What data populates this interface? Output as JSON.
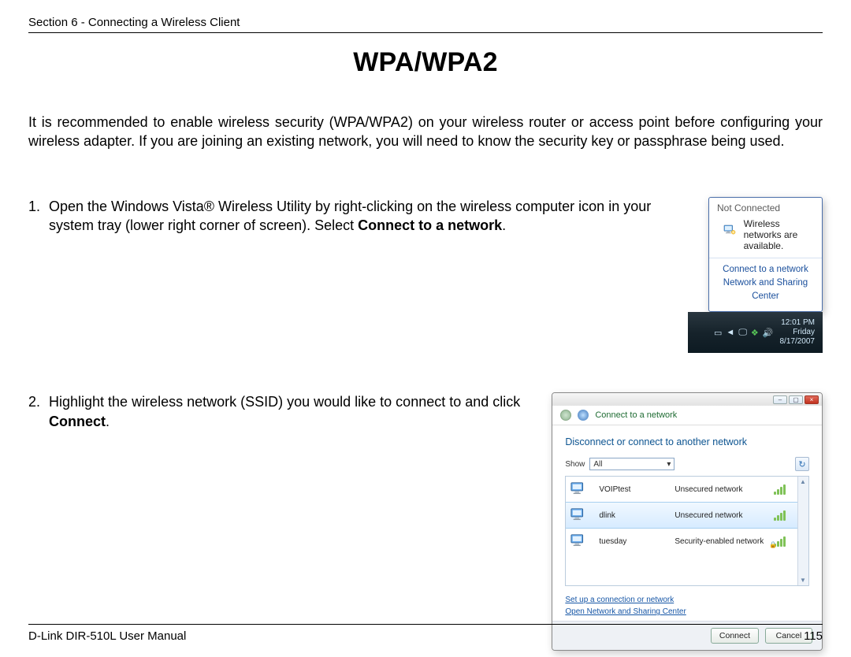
{
  "header": {
    "section": "Section 6 - Connecting a Wireless Client"
  },
  "title": "WPA/WPA2",
  "intro": "It is recommended to enable wireless security (WPA/WPA2) on your wireless router or access point before configuring your wireless adapter. If you are joining an existing network, you will need to know the security key or passphrase being used.",
  "steps": {
    "s1_a": "Open the Windows Vista® Wireless Utility by right-clicking on the wireless computer icon in your system tray (lower right corner of screen). Select ",
    "s1_b": "Connect to a network",
    "s1_c": ".",
    "s2_a": "Highlight the wireless network (SSID) you would like to connect to and click ",
    "s2_b": "Connect",
    "s2_c": "."
  },
  "fig1": {
    "not_connected": "Not Connected",
    "available": "Wireless networks are available.",
    "link_connect": "Connect to a network",
    "link_center": "Network and Sharing Center",
    "time": "12:01 PM",
    "day": "Friday",
    "date": "8/17/2007"
  },
  "fig2": {
    "title": "Connect to a network",
    "heading": "Disconnect or connect to another network",
    "show_label": "Show",
    "show_value": "All",
    "networks": [
      {
        "ssid": "VOIPtest",
        "security": "Unsecured network",
        "lock": false
      },
      {
        "ssid": "dlink",
        "security": "Unsecured network",
        "lock": false,
        "selected": true
      },
      {
        "ssid": "tuesday",
        "security": "Security-enabled network",
        "lock": true
      }
    ],
    "link_setup": "Set up a connection or network",
    "link_open": "Open Network and Sharing Center",
    "btn_connect": "Connect",
    "btn_cancel": "Cancel"
  },
  "footer": {
    "left": "D-Link DIR-510L User Manual",
    "right": "115"
  }
}
